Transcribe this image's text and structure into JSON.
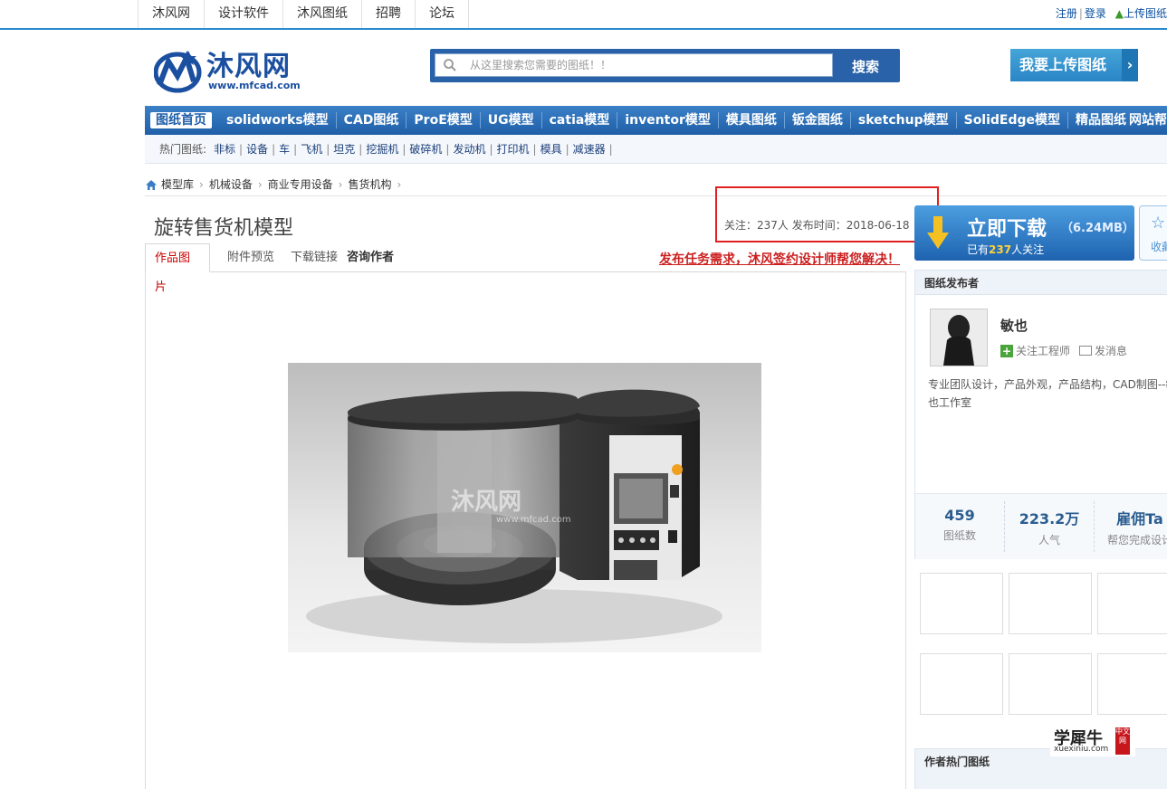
{
  "top_nav": {
    "items": [
      "沐风网",
      "设计软件",
      "沐风图纸",
      "招聘",
      "论坛"
    ],
    "register": "注册",
    "login": "登录",
    "separator": "|",
    "upload": "上传图纸"
  },
  "header": {
    "logo_text": "沐风网",
    "logo_url": "www.mfcad.com",
    "search_placeholder": "从这里搜索您需要的图纸！！",
    "search_button": "搜索",
    "upload_button": "我要上传图纸",
    "upload_arrow": "›"
  },
  "category_nav": {
    "items": [
      "图纸首页",
      "solidworks模型",
      "CAD图纸",
      "ProE模型",
      "UG模型",
      "catia模型",
      "inventor模型",
      "模具图纸",
      "钣金图纸",
      "sketchup模型",
      "SolidEdge模型",
      "精品图纸"
    ],
    "right": "网站帮"
  },
  "hot_bar": {
    "label": "热门图纸:",
    "items": [
      "非标",
      "设备",
      "车",
      "飞机",
      "坦克",
      "挖掘机",
      "破碎机",
      "发动机",
      "打印机",
      "模具",
      "减速器"
    ]
  },
  "breadcrumb": [
    "模型库",
    "机械设备",
    "商业专用设备",
    "售货机构"
  ],
  "page": {
    "title": "旋转售货机模型",
    "meta": "关注：237人  发布时间：2018-06-18",
    "tabs": [
      "作品图片",
      "附件预览",
      "下载链接",
      "咨询作者"
    ],
    "task_link": "发布任务需求，沐风签约设计师帮您解决！",
    "image_watermark": "沐风网",
    "image_watermark_url": "www.mfcad.com"
  },
  "download": {
    "title": "立即下载",
    "size": "（6.24MB）",
    "sub_prefix": "已有",
    "sub_count": "237",
    "sub_suffix": "人关注",
    "fav_label": "收藏"
  },
  "publisher": {
    "heading": "图纸发布者",
    "name": "敏也",
    "follow": "关注工程师",
    "message": "发消息",
    "desc": "专业团队设计，产品外观，产品结构，CAD制图--敏也工作室",
    "stats": [
      {
        "num": "459",
        "label": "图纸数"
      },
      {
        "num": "223.2万",
        "label": "人气"
      },
      {
        "num": "雇佣Ta",
        "label": "帮您完成设计"
      }
    ]
  },
  "hot_works": {
    "heading": "作者热门图纸"
  },
  "watermark": {
    "text": "学犀牛",
    "url": "xuexiniu.com",
    "badge": "中文网"
  }
}
